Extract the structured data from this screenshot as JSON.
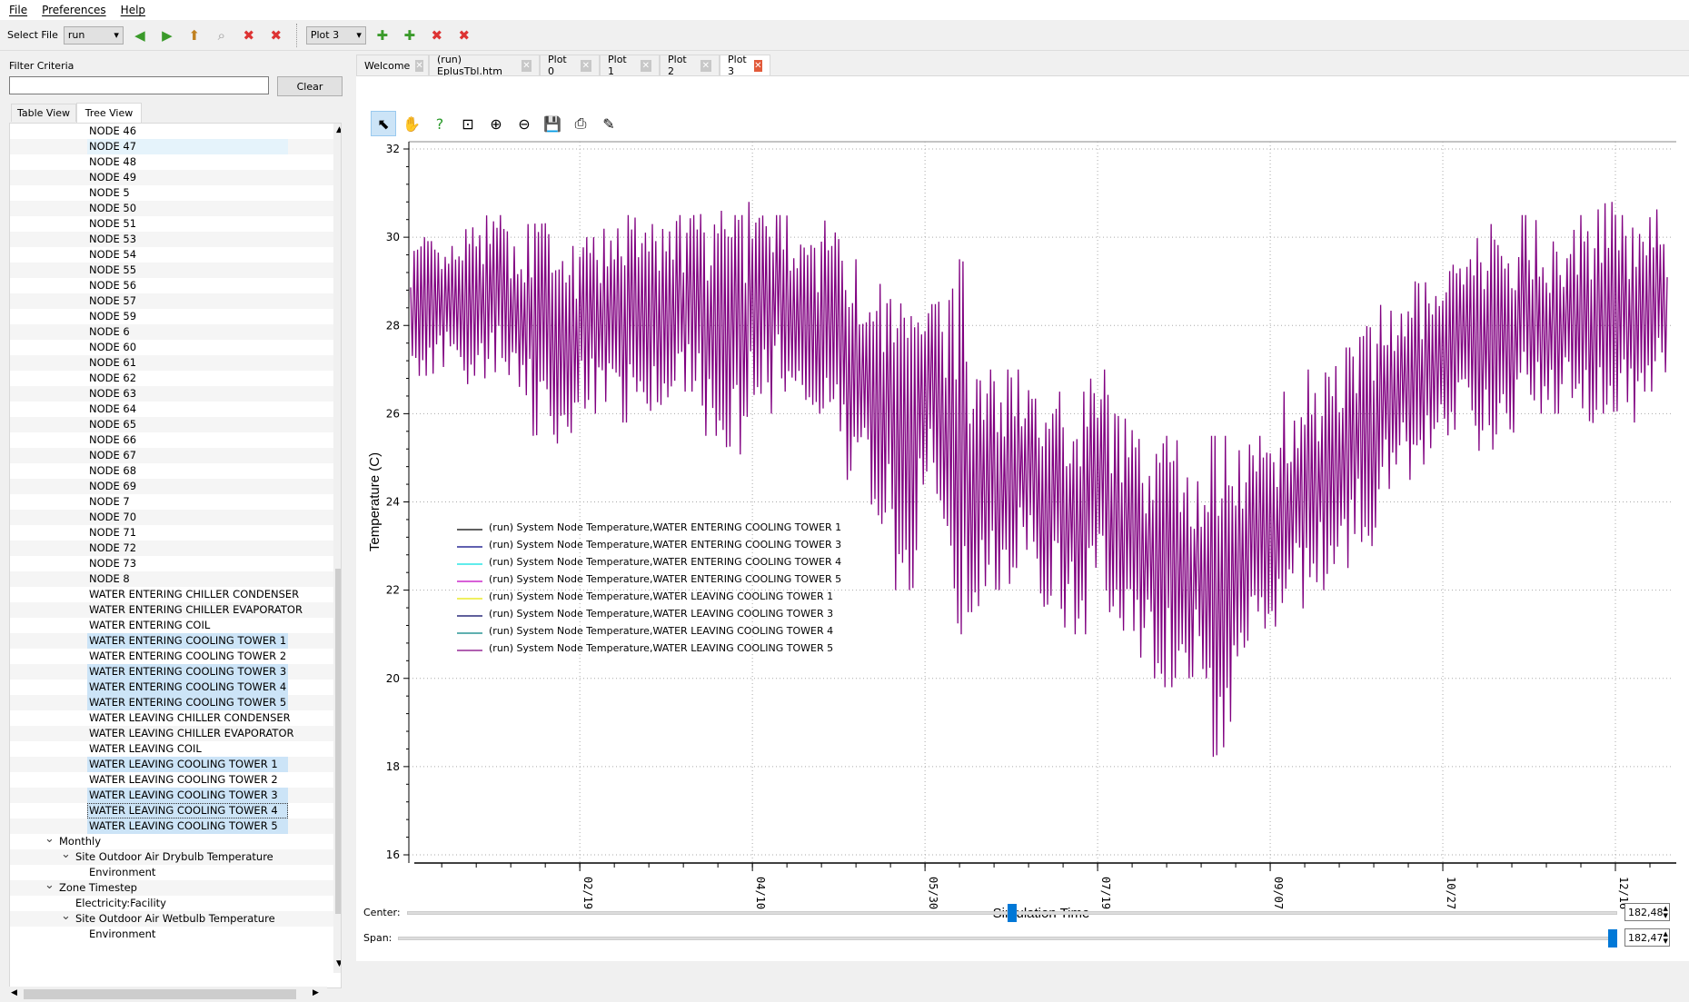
{
  "menu": {
    "file": "File",
    "preferences": "Preferences",
    "help": "Help"
  },
  "toolbar": {
    "select_file_label": "Select File",
    "file_value": "run",
    "plot_value": "Plot 3"
  },
  "left": {
    "filter_label": "Filter Criteria",
    "filter_value": "",
    "clear": "Clear",
    "tabs": [
      "Table View",
      "Tree View"
    ],
    "active_tab": "Tree View",
    "tree": [
      {
        "label": "NODE 46",
        "level": 3
      },
      {
        "label": "NODE 47",
        "level": 3,
        "state": "hover"
      },
      {
        "label": "NODE 48",
        "level": 3
      },
      {
        "label": "NODE 49",
        "level": 3
      },
      {
        "label": "NODE 5",
        "level": 3
      },
      {
        "label": "NODE 50",
        "level": 3
      },
      {
        "label": "NODE 51",
        "level": 3
      },
      {
        "label": "NODE 53",
        "level": 3
      },
      {
        "label": "NODE 54",
        "level": 3
      },
      {
        "label": "NODE 55",
        "level": 3
      },
      {
        "label": "NODE 56",
        "level": 3
      },
      {
        "label": "NODE 57",
        "level": 3
      },
      {
        "label": "NODE 59",
        "level": 3
      },
      {
        "label": "NODE 6",
        "level": 3
      },
      {
        "label": "NODE 60",
        "level": 3
      },
      {
        "label": "NODE 61",
        "level": 3
      },
      {
        "label": "NODE 62",
        "level": 3
      },
      {
        "label": "NODE 63",
        "level": 3
      },
      {
        "label": "NODE 64",
        "level": 3
      },
      {
        "label": "NODE 65",
        "level": 3
      },
      {
        "label": "NODE 66",
        "level": 3
      },
      {
        "label": "NODE 67",
        "level": 3
      },
      {
        "label": "NODE 68",
        "level": 3
      },
      {
        "label": "NODE 69",
        "level": 3
      },
      {
        "label": "NODE 7",
        "level": 3
      },
      {
        "label": "NODE 70",
        "level": 3
      },
      {
        "label": "NODE 71",
        "level": 3
      },
      {
        "label": "NODE 72",
        "level": 3
      },
      {
        "label": "NODE 73",
        "level": 3
      },
      {
        "label": "NODE 8",
        "level": 3
      },
      {
        "label": "WATER ENTERING CHILLER CONDENSER",
        "level": 3
      },
      {
        "label": "WATER ENTERING CHILLER EVAPORATOR",
        "level": 3
      },
      {
        "label": "WATER ENTERING COIL",
        "level": 3
      },
      {
        "label": "WATER ENTERING COOLING TOWER 1",
        "level": 3,
        "state": "selected"
      },
      {
        "label": "WATER ENTERING COOLING TOWER 2",
        "level": 3
      },
      {
        "label": "WATER ENTERING COOLING TOWER 3",
        "level": 3,
        "state": "selected"
      },
      {
        "label": "WATER ENTERING COOLING TOWER 4",
        "level": 3,
        "state": "selected"
      },
      {
        "label": "WATER ENTERING COOLING TOWER 5",
        "level": 3,
        "state": "selected"
      },
      {
        "label": "WATER LEAVING CHILLER CONDENSER",
        "level": 3
      },
      {
        "label": "WATER LEAVING CHILLER EVAPORATOR",
        "level": 3
      },
      {
        "label": "WATER LEAVING COIL",
        "level": 3
      },
      {
        "label": "WATER LEAVING COOLING TOWER 1",
        "level": 3,
        "state": "selected"
      },
      {
        "label": "WATER LEAVING COOLING TOWER 2",
        "level": 3
      },
      {
        "label": "WATER LEAVING COOLING TOWER 3",
        "level": 3,
        "state": "selected"
      },
      {
        "label": "WATER LEAVING COOLING TOWER 4",
        "level": 3,
        "state": "focus"
      },
      {
        "label": "WATER LEAVING COOLING TOWER 5",
        "level": 3,
        "state": "selected"
      },
      {
        "label": "Monthly",
        "level": 1,
        "expanded": true
      },
      {
        "label": "Site Outdoor Air Drybulb Temperature",
        "level": 2,
        "expanded": true
      },
      {
        "label": "Environment",
        "level": 3
      },
      {
        "label": "Zone Timestep",
        "level": 1,
        "expanded": true
      },
      {
        "label": "Electricity:Facility",
        "level": 2
      },
      {
        "label": "Site Outdoor Air Wetbulb Temperature",
        "level": 2,
        "expanded": true
      },
      {
        "label": "Environment",
        "level": 3
      }
    ]
  },
  "tabs": [
    {
      "label": "Welcome"
    },
    {
      "label": "(run) EplusTbl.htm"
    },
    {
      "label": "Plot 0"
    },
    {
      "label": "Plot 1"
    },
    {
      "label": "Plot 2"
    },
    {
      "label": "Plot 3",
      "active": true
    }
  ],
  "plot_tools": [
    "select-icon",
    "pan-icon",
    "whats-this-icon",
    "zoom-box-icon",
    "zoom-in-icon",
    "zoom-out-icon",
    "save-icon",
    "print-icon",
    "line-style-icon"
  ],
  "sliders": {
    "center_label": "Center:",
    "center_value": "182,48",
    "center_fraction": 0.5,
    "span_label": "Span:",
    "span_value": "182,47",
    "span_fraction": 1.0
  },
  "chart_data": {
    "type": "line",
    "xlabel": "Simulation Time",
    "ylabel": "Temperature (C)",
    "ylim": [
      16,
      32
    ],
    "yticks": [
      16,
      18,
      20,
      22,
      24,
      26,
      28,
      30,
      32
    ],
    "xticks": [
      {
        "label": "02/19",
        "day": 49
      },
      {
        "label": "04/10",
        "day": 99
      },
      {
        "label": "05/30",
        "day": 149
      },
      {
        "label": "07/19",
        "day": 199
      },
      {
        "label": "09/07",
        "day": 249
      },
      {
        "label": "10/27",
        "day": 299
      },
      {
        "label": "12/16",
        "day": 349
      }
    ],
    "xlim_days": [
      0,
      364
    ],
    "grid": true,
    "legend_position": "left-middle",
    "series": [
      {
        "name": "(run) System Node Temperature,WATER ENTERING COOLING TOWER 1",
        "color": "#000000"
      },
      {
        "name": "(run) System Node Temperature,WATER ENTERING COOLING TOWER 3",
        "color": "#000080"
      },
      {
        "name": "(run) System Node Temperature,WATER ENTERING COOLING TOWER 4",
        "color": "#00e0e0"
      },
      {
        "name": "(run) System Node Temperature,WATER ENTERING COOLING TOWER 5",
        "color": "#c000c0"
      },
      {
        "name": "(run) System Node Temperature,WATER LEAVING COOLING TOWER 1",
        "color": "#e8e800"
      },
      {
        "name": "(run) System Node Temperature,WATER LEAVING COOLING TOWER 3",
        "color": "#000060"
      },
      {
        "name": "(run) System Node Temperature,WATER LEAVING COOLING TOWER 4",
        "color": "#008080"
      },
      {
        "name": "(run) System Node Temperature,WATER LEAVING COOLING TOWER 5",
        "color": "#800080"
      }
    ],
    "visible_series_weekly_range": [
      [
        26.5,
        30
      ],
      [
        27,
        29.8
      ],
      [
        26.5,
        30.3
      ],
      [
        26.8,
        30.5
      ],
      [
        26,
        30.3
      ],
      [
        25.5,
        30.5
      ],
      [
        25.2,
        29.8
      ],
      [
        26,
        30
      ],
      [
        25.8,
        30.2
      ],
      [
        26,
        30.5
      ],
      [
        26.2,
        30.3
      ],
      [
        26.5,
        30.5
      ],
      [
        25.5,
        30.6
      ],
      [
        25,
        30.5
      ],
      [
        26,
        30.8
      ],
      [
        26.5,
        30.5
      ],
      [
        26,
        30
      ],
      [
        25.5,
        30.6
      ],
      [
        24.5,
        29.5
      ],
      [
        23.5,
        29
      ],
      [
        22,
        28.5
      ],
      [
        24,
        29.5
      ],
      [
        21,
        29.5
      ],
      [
        21.5,
        27.5
      ],
      [
        22,
        27
      ],
      [
        22.5,
        27
      ],
      [
        21.5,
        26.5
      ],
      [
        21,
        26.5
      ],
      [
        21.5,
        27
      ],
      [
        20.5,
        26
      ],
      [
        20,
        25.5
      ],
      [
        19.8,
        25.5
      ],
      [
        20,
        25
      ],
      [
        18,
        25.5
      ],
      [
        20.5,
        25.3
      ],
      [
        21,
        25.5
      ],
      [
        21.5,
        26.5
      ],
      [
        22,
        27
      ],
      [
        22.5,
        27.5
      ],
      [
        23,
        28
      ],
      [
        24,
        28.5
      ],
      [
        24.5,
        29
      ],
      [
        25,
        29
      ],
      [
        25.5,
        29.5
      ],
      [
        25,
        30.3
      ],
      [
        25.5,
        30
      ],
      [
        26,
        30.5
      ],
      [
        26,
        30
      ],
      [
        25.5,
        30.5
      ],
      [
        26,
        30.8
      ],
      [
        25.8,
        30.5
      ],
      [
        26.5,
        31
      ],
      [
        26.5,
        30.2
      ]
    ]
  }
}
